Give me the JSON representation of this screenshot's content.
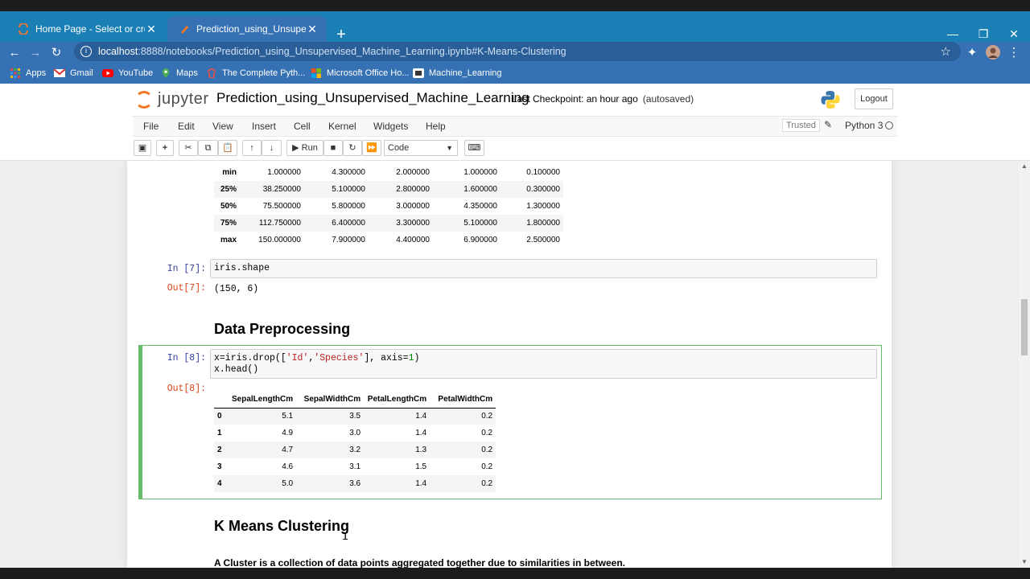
{
  "browser": {
    "tabs": [
      {
        "title": "Home Page - Select or create a n",
        "active": false
      },
      {
        "title": "Prediction_using_Unsupervised_N",
        "active": true
      }
    ],
    "new_tab": "+",
    "url_host": "localhost",
    "url_path": ":8888/notebooks/Prediction_using_Unsupervised_Machine_Learning.ipynb#K-Means-Clustering",
    "bookmarks": [
      "Apps",
      "Gmail",
      "YouTube",
      "Maps",
      "The Complete Pyth...",
      "Microsoft Office Ho...",
      "Machine_Learning"
    ]
  },
  "jupyter": {
    "logo_text": "jupyter",
    "notebook_name": "Prediction_using_Unsupervised_Machine_Learning",
    "checkpoint": "Last Checkpoint: an hour ago",
    "autosaved": "(autosaved)",
    "logout": "Logout",
    "menus": [
      "File",
      "Edit",
      "View",
      "Insert",
      "Cell",
      "Kernel",
      "Widgets",
      "Help"
    ],
    "trusted": "Trusted",
    "kernel_name": "Python 3",
    "toolbar": {
      "run_label": "Run",
      "cell_type": "Code"
    }
  },
  "describe_table": {
    "rows": [
      {
        "label": "min",
        "values": [
          "1.000000",
          "4.300000",
          "2.000000",
          "1.000000",
          "0.100000"
        ]
      },
      {
        "label": "25%",
        "values": [
          "38.250000",
          "5.100000",
          "2.800000",
          "1.600000",
          "0.300000"
        ]
      },
      {
        "label": "50%",
        "values": [
          "75.500000",
          "5.800000",
          "3.000000",
          "4.350000",
          "1.300000"
        ]
      },
      {
        "label": "75%",
        "values": [
          "112.750000",
          "6.400000",
          "3.300000",
          "5.100000",
          "1.800000"
        ]
      },
      {
        "label": "max",
        "values": [
          "150.000000",
          "7.900000",
          "4.400000",
          "6.900000",
          "2.500000"
        ]
      }
    ]
  },
  "cell7": {
    "in_prompt": "In [7]:",
    "code": "iris.shape",
    "out_prompt": "Out[7]:",
    "output": "(150, 6)"
  },
  "heading_preprocessing": "Data Preprocessing",
  "cell8": {
    "in_prompt": "In [8]:",
    "code_line1_a": "x=iris.drop([",
    "code_line1_s1": "'Id'",
    "code_line1_comma": ",",
    "code_line1_s2": "'Species'",
    "code_line1_b": "], axis=",
    "code_line1_n": "1",
    "code_line1_c": ")",
    "code_line2": "x.head()",
    "out_prompt": "Out[8]:",
    "columns": [
      "SepalLengthCm",
      "SepalWidthCm",
      "PetalLengthCm",
      "PetalWidthCm"
    ],
    "rows": [
      {
        "index": "0",
        "values": [
          "5.1",
          "3.5",
          "1.4",
          "0.2"
        ]
      },
      {
        "index": "1",
        "values": [
          "4.9",
          "3.0",
          "1.4",
          "0.2"
        ]
      },
      {
        "index": "2",
        "values": [
          "4.7",
          "3.2",
          "1.3",
          "0.2"
        ]
      },
      {
        "index": "3",
        "values": [
          "4.6",
          "3.1",
          "1.5",
          "0.2"
        ]
      },
      {
        "index": "4",
        "values": [
          "5.0",
          "3.6",
          "1.4",
          "0.2"
        ]
      }
    ]
  },
  "heading_kmeans": "K Means Clustering",
  "kmeans_text": "A Cluster is a collection of data points aggregated together due to similarities in between."
}
